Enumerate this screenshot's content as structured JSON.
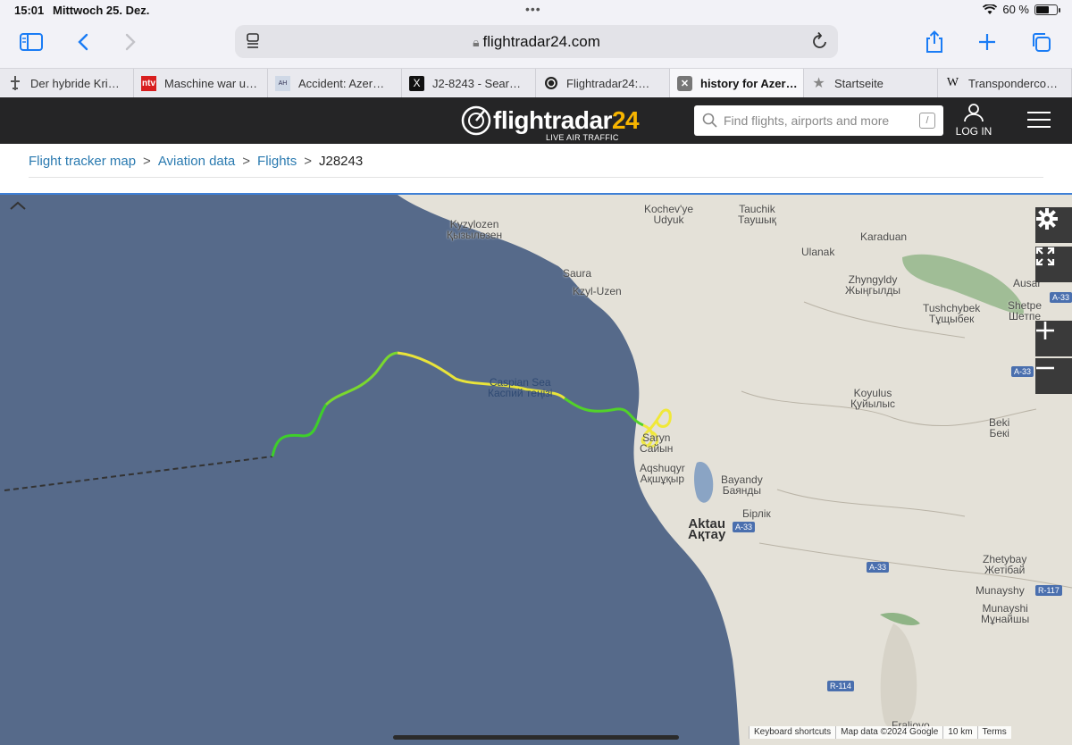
{
  "status": {
    "time": "15:01",
    "date": "Mittwoch 25. Dez.",
    "battery": "60 %"
  },
  "browser": {
    "url": "flightradar24.com",
    "tabs": [
      {
        "label": "Der hybride Kri…",
        "icon": "plane-icon"
      },
      {
        "label": "Maschine war u…",
        "icon": "ntv-icon"
      },
      {
        "label": "Accident: Azer…",
        "icon": "avherald-icon"
      },
      {
        "label": "J2-8243 - Sear…",
        "icon": "x-icon"
      },
      {
        "label": "Flightradar24:…",
        "icon": "fr24-icon"
      },
      {
        "label": "history for Azer…",
        "icon": "close-icon",
        "active": true
      },
      {
        "label": "Startseite",
        "icon": "star-icon"
      },
      {
        "label": "Transponderco…",
        "icon": "wikipedia-icon"
      }
    ]
  },
  "site": {
    "logo_word": "flightradar",
    "logo_num": "24",
    "logo_sub": "LIVE AIR TRAFFIC",
    "search_placeholder": "Find flights, airports and more",
    "search_shortcut": "/",
    "login": "LOG IN"
  },
  "breadcrumb": {
    "items": [
      "Flight tracker map",
      "Aviation data",
      "Flights"
    ],
    "separator": ">",
    "current": "J28243"
  },
  "map": {
    "sea_label": "Caspian Sea",
    "sea_label_local": "Каспий теңізі",
    "places": [
      {
        "name": "Kyzylozen",
        "local": "Қызылөзен"
      },
      {
        "name": "Kochev'ye",
        "local": "Udyuk"
      },
      {
        "name": "Tauchik",
        "local": "Таушық"
      },
      {
        "name": "Ulanak",
        "local": ""
      },
      {
        "name": "Karaduan",
        "local": ""
      },
      {
        "name": "Saura",
        "local": ""
      },
      {
        "name": "Kzyl-Uzen",
        "local": ""
      },
      {
        "name": "Zhyngyldy",
        "local": "Жыңгылды"
      },
      {
        "name": "Ausar",
        "local": ""
      },
      {
        "name": "Tushchybek",
        "local": "Тұщыбек"
      },
      {
        "name": "Shetpe",
        "local": "Шетпе"
      },
      {
        "name": "Koyulus",
        "local": "Қуйылыс"
      },
      {
        "name": "Beki",
        "local": "Бекі"
      },
      {
        "name": "Saryn",
        "local": "Сайын"
      },
      {
        "name": "Aqshuqyr",
        "local": "Ақшұқыр"
      },
      {
        "name": "Bayandy",
        "local": "Баянды"
      },
      {
        "name": "Бірлік",
        "local": ""
      },
      {
        "name": "Aktau",
        "local": "Ақтау"
      },
      {
        "name": "Zhetybay",
        "local": "Жетібай"
      },
      {
        "name": "Munayshy",
        "local": ""
      },
      {
        "name": "Munayshi",
        "local": "Мұнайшы"
      },
      {
        "name": "Fraliovo",
        "local": ""
      }
    ],
    "roads": [
      "A-33",
      "A-33",
      "A-33",
      "A-33",
      "R-117",
      "R-114"
    ],
    "footer": [
      "Keyboard shortcuts",
      "Map data ©2024 Google",
      "10 km",
      "Terms"
    ],
    "colors": {
      "sea": "#566a8a",
      "land": "#e4e1d8",
      "track_green": "#3ecf2a",
      "track_yellow": "#f0e838",
      "accent": "#f7b500"
    }
  }
}
